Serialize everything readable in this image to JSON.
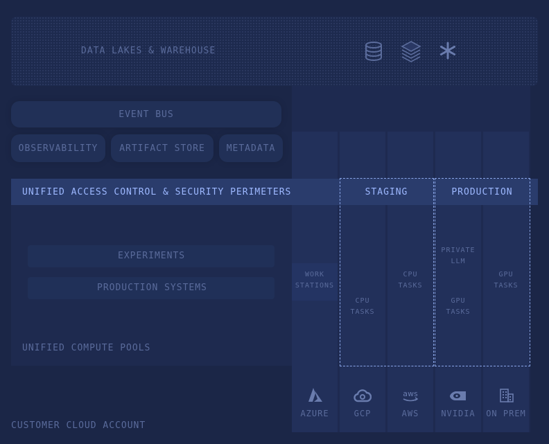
{
  "data_lakes": {
    "label": "DATA LAKES & WAREHOUSE",
    "icons": [
      "database-icon",
      "layers-icon",
      "snowflake-icon"
    ]
  },
  "event_bus": {
    "label": "EVENT BUS"
  },
  "services": [
    {
      "label": "OBSERVABILITY"
    },
    {
      "label": "ARTIFACT STORE"
    },
    {
      "label": "METADATA"
    }
  ],
  "security_bar": {
    "label": "UNIFIED ACCESS CONTROL & SECURITY PERIMETERS"
  },
  "environments": {
    "staging": "STAGING",
    "production": "PRODUCTION"
  },
  "workloads": {
    "experiments": "EXPERIMENTS",
    "production_systems": "PRODUCTION SYSTEMS"
  },
  "compute_pools": {
    "label": "UNIFIED COMPUTE POOLS"
  },
  "tasks": {
    "azure": [
      "WORK",
      "STATIONS"
    ],
    "gcp": [
      "CPU",
      "TASKS"
    ],
    "aws": [
      "CPU",
      "TASKS"
    ],
    "nvidia_top": [
      "PRIVATE",
      "LLM"
    ],
    "nvidia_bottom": [
      "GPU",
      "TASKS"
    ],
    "onprem": [
      "GPU",
      "TASKS"
    ]
  },
  "vendors": [
    {
      "label": "AZURE",
      "icon": "azure-icon"
    },
    {
      "label": "GCP",
      "icon": "gcp-cloud-icon"
    },
    {
      "label": "AWS",
      "icon": "aws-icon"
    },
    {
      "label": "NVIDIA",
      "icon": "nvidia-icon"
    },
    {
      "label": "ON PREM",
      "icon": "building-icon"
    }
  ],
  "customer_account": {
    "label": "CUSTOMER CLOUD ACCOUNT"
  },
  "colors": {
    "background": "#1b2647",
    "accent": "#8fb0ff",
    "text_muted": "#5a6b9b"
  }
}
